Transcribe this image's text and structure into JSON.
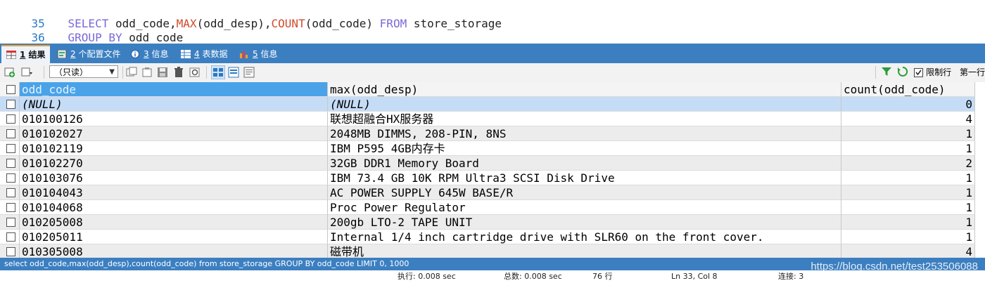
{
  "editor": {
    "lines": [
      {
        "num": "35",
        "kw1": "SELECT",
        "t1": " odd_code,",
        "fn1": "MAX",
        "t2": "(odd_desp),",
        "fn2": "COUNT",
        "t3": "(odd_code) ",
        "kw2": "FROM",
        "t4": " store_storage"
      },
      {
        "num": "36",
        "kw1": "GROUP BY",
        "t1": " odd_code"
      }
    ]
  },
  "tabs": [
    {
      "num": "1",
      "label": " 结果",
      "icon": "result-grid-icon"
    },
    {
      "num": "2",
      "label": " 个配置文件",
      "icon": "profile-icon"
    },
    {
      "num": "3",
      "label": " 信息",
      "icon": "info-icon"
    },
    {
      "num": "4",
      "label": " 表数据",
      "icon": "table-data-icon"
    },
    {
      "num": "5",
      "label": " 信息",
      "icon": "messages-icon"
    }
  ],
  "toolbar": {
    "readonly_select": "（只读）",
    "limit_rows_label": "限制行",
    "first_row_label": "第一行"
  },
  "grid": {
    "columns": [
      "odd_code",
      "max(odd_desp)",
      "count(odd_code)"
    ],
    "rows": [
      [
        "(NULL)",
        "(NULL)",
        "0"
      ],
      [
        "010100126",
        "联想超融合HX服务器",
        "4"
      ],
      [
        "010102027",
        "2048MB DIMMS, 208-PIN, 8NS",
        "1"
      ],
      [
        "010102119",
        "IBM P595 4GB内存卡",
        "1"
      ],
      [
        "010102270",
        "32GB DDR1 Memory Board",
        "2"
      ],
      [
        "010103076",
        "IBM 73.4 GB 10K RPM Ultra3 SCSI Disk Drive",
        "1"
      ],
      [
        "010104043",
        "AC POWER SUPPLY 645W BASE/R",
        "1"
      ],
      [
        "010104068",
        "Proc Power Regulator",
        "1"
      ],
      [
        "010205008",
        "200gb LTO-2 TAPE UNIT",
        "1"
      ],
      [
        "010205011",
        "Internal 1/4 inch cartridge drive with SLR60 on the front cover.",
        "1"
      ],
      [
        "010305008",
        "磁带机",
        "4"
      ]
    ]
  },
  "status": {
    "query": "select odd_code,max(odd_desp),count(odd_code) from store_storage GROUP BY odd_code LIMIT 0, 1000",
    "exec": "执行: 0.008 sec",
    "total": "总数: 0.008 sec",
    "rows": "76 行",
    "position": "Ln 33, Col 8",
    "connection": "连接: 3",
    "watermark": "https://blog.csdn.net/test253506088"
  },
  "colors": {
    "tab_bar": "#3c7fc1",
    "header_selected": "#4aa3e8",
    "null_row": "#c5dcf6"
  }
}
